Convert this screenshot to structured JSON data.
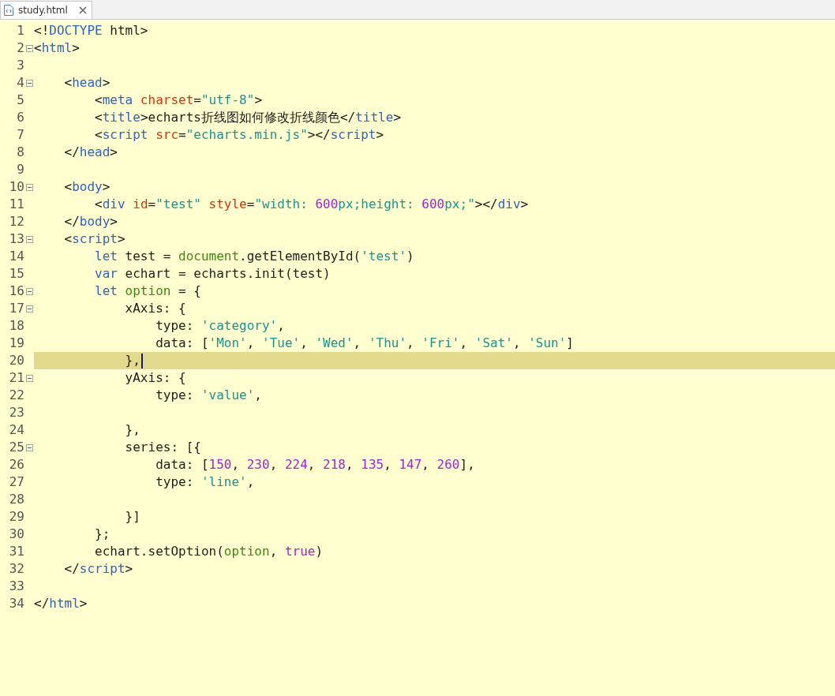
{
  "tab": {
    "label": "study.html",
    "selected": true
  },
  "lines": [
    {
      "number": "1",
      "foldable": false,
      "current": false,
      "tokens": [
        {
          "kind": "plain",
          "text": "<!"
        },
        {
          "kind": "tag",
          "text": "DOCTYPE"
        },
        {
          "kind": "plain",
          "text": " html>"
        }
      ]
    },
    {
      "number": "2",
      "foldable": true,
      "current": false,
      "tokens": [
        {
          "kind": "plain",
          "text": "<"
        },
        {
          "kind": "tag",
          "text": "html"
        },
        {
          "kind": "plain",
          "text": ">"
        }
      ]
    },
    {
      "number": "3",
      "foldable": false,
      "current": false
    },
    {
      "number": "4",
      "foldable": true,
      "current": false,
      "tokens": [
        {
          "kind": "plain",
          "text": "    <"
        },
        {
          "kind": "tag",
          "text": "head"
        },
        {
          "kind": "plain",
          "text": ">"
        }
      ]
    },
    {
      "number": "5",
      "foldable": false,
      "current": false,
      "tokens": [
        {
          "kind": "plain",
          "text": "        <"
        },
        {
          "kind": "tag",
          "text": "meta"
        },
        {
          "kind": "attr",
          "text": " charset"
        },
        {
          "kind": "plain",
          "text": "="
        },
        {
          "kind": "string",
          "text": "\"utf-8\""
        },
        {
          "kind": "plain",
          "text": ">"
        }
      ]
    },
    {
      "number": "6",
      "foldable": false,
      "current": false,
      "tokens": [
        {
          "kind": "plain",
          "text": "        <"
        },
        {
          "kind": "tag",
          "text": "title"
        },
        {
          "kind": "plain",
          "text": ">echarts折线图如何修改折线颜色</"
        },
        {
          "kind": "tag",
          "text": "title"
        },
        {
          "kind": "plain",
          "text": ">"
        }
      ]
    },
    {
      "number": "7",
      "foldable": false,
      "current": false,
      "tokens": [
        {
          "kind": "plain",
          "text": "        <"
        },
        {
          "kind": "tag",
          "text": "script"
        },
        {
          "kind": "attr",
          "text": " src"
        },
        {
          "kind": "plain",
          "text": "="
        },
        {
          "kind": "string",
          "text": "\"echarts.min.js\""
        },
        {
          "kind": "plain",
          "text": "></"
        },
        {
          "kind": "tag",
          "text": "script"
        },
        {
          "kind": "plain",
          "text": ">"
        }
      ]
    },
    {
      "number": "8",
      "foldable": false,
      "current": false,
      "tokens": [
        {
          "kind": "plain",
          "text": "    </"
        },
        {
          "kind": "tag",
          "text": "head"
        },
        {
          "kind": "plain",
          "text": ">"
        }
      ]
    },
    {
      "number": "9",
      "foldable": false,
      "current": false
    },
    {
      "number": "10",
      "foldable": true,
      "current": false,
      "tokens": [
        {
          "kind": "plain",
          "text": "    <"
        },
        {
          "kind": "tag",
          "text": "body"
        },
        {
          "kind": "plain",
          "text": ">"
        }
      ]
    },
    {
      "number": "11",
      "foldable": false,
      "current": false,
      "tokens": [
        {
          "kind": "plain",
          "text": "        <"
        },
        {
          "kind": "tag",
          "text": "div"
        },
        {
          "kind": "attr",
          "text": " id"
        },
        {
          "kind": "plain",
          "text": "="
        },
        {
          "kind": "string",
          "text": "\"test\""
        },
        {
          "kind": "attr",
          "text": " style"
        },
        {
          "kind": "plain",
          "text": "="
        },
        {
          "kind": "string",
          "text": "\"width: "
        },
        {
          "kind": "number",
          "text": "600"
        },
        {
          "kind": "string",
          "text": "px;height: "
        },
        {
          "kind": "number",
          "text": "600"
        },
        {
          "kind": "string",
          "text": "px;\""
        },
        {
          "kind": "plain",
          "text": "></"
        },
        {
          "kind": "tag",
          "text": "div"
        },
        {
          "kind": "plain",
          "text": ">"
        }
      ]
    },
    {
      "number": "12",
      "foldable": false,
      "current": false,
      "tokens": [
        {
          "kind": "plain",
          "text": "    </"
        },
        {
          "kind": "tag",
          "text": "body"
        },
        {
          "kind": "plain",
          "text": ">"
        }
      ]
    },
    {
      "number": "13",
      "foldable": true,
      "current": false,
      "tokens": [
        {
          "kind": "plain",
          "text": "    <"
        },
        {
          "kind": "tag",
          "text": "script"
        },
        {
          "kind": "plain",
          "text": ">"
        }
      ]
    },
    {
      "number": "14",
      "foldable": false,
      "current": false,
      "tokens": [
        {
          "kind": "keyword",
          "text": "        let"
        },
        {
          "kind": "plain",
          "text": " test = "
        },
        {
          "kind": "global",
          "text": "document"
        },
        {
          "kind": "plain",
          "text": ".getElementById("
        },
        {
          "kind": "string",
          "text": "'test'"
        },
        {
          "kind": "plain",
          "text": ")"
        }
      ]
    },
    {
      "number": "15",
      "foldable": false,
      "current": false,
      "tokens": [
        {
          "kind": "keyword",
          "text": "        var"
        },
        {
          "kind": "plain",
          "text": " echart = echarts.init(test)"
        }
      ]
    },
    {
      "number": "16",
      "foldable": true,
      "current": false,
      "tokens": [
        {
          "kind": "keyword",
          "text": "        let"
        },
        {
          "kind": "global",
          "text": " option"
        },
        {
          "kind": "plain",
          "text": " = {"
        }
      ]
    },
    {
      "number": "17",
      "foldable": true,
      "current": false,
      "tokens": [
        {
          "kind": "plain",
          "text": "            xAxis: {"
        }
      ]
    },
    {
      "number": "18",
      "foldable": false,
      "current": false,
      "tokens": [
        {
          "kind": "plain",
          "text": "                type: "
        },
        {
          "kind": "string",
          "text": "'category'"
        },
        {
          "kind": "plain",
          "text": ","
        }
      ]
    },
    {
      "number": "19",
      "foldable": false,
      "current": false,
      "tokens": [
        {
          "kind": "plain",
          "text": "                data: ["
        },
        {
          "kind": "string",
          "text": "'Mon'"
        },
        {
          "kind": "plain",
          "text": ", "
        },
        {
          "kind": "string",
          "text": "'Tue'"
        },
        {
          "kind": "plain",
          "text": ", "
        },
        {
          "kind": "string",
          "text": "'Wed'"
        },
        {
          "kind": "plain",
          "text": ", "
        },
        {
          "kind": "string",
          "text": "'Thu'"
        },
        {
          "kind": "plain",
          "text": ", "
        },
        {
          "kind": "string",
          "text": "'Fri'"
        },
        {
          "kind": "plain",
          "text": ", "
        },
        {
          "kind": "string",
          "text": "'Sat'"
        },
        {
          "kind": "plain",
          "text": ", "
        },
        {
          "kind": "string",
          "text": "'Sun'"
        },
        {
          "kind": "plain",
          "text": "]"
        }
      ]
    },
    {
      "number": "20",
      "foldable": false,
      "current": true,
      "tokens": [
        {
          "kind": "plain",
          "text": "            },"
        }
      ]
    },
    {
      "number": "21",
      "foldable": true,
      "current": false,
      "tokens": [
        {
          "kind": "plain",
          "text": "            yAxis: {"
        }
      ]
    },
    {
      "number": "22",
      "foldable": false,
      "current": false,
      "tokens": [
        {
          "kind": "plain",
          "text": "                type: "
        },
        {
          "kind": "string",
          "text": "'value'"
        },
        {
          "kind": "plain",
          "text": ","
        }
      ]
    },
    {
      "number": "23",
      "foldable": false,
      "current": false
    },
    {
      "number": "24",
      "foldable": false,
      "current": false,
      "tokens": [
        {
          "kind": "plain",
          "text": "            },"
        }
      ]
    },
    {
      "number": "25",
      "foldable": true,
      "current": false,
      "tokens": [
        {
          "kind": "plain",
          "text": "            series: [{"
        }
      ]
    },
    {
      "number": "26",
      "foldable": false,
      "current": false,
      "tokens": [
        {
          "kind": "plain",
          "text": "                data: ["
        },
        {
          "kind": "number",
          "text": "150"
        },
        {
          "kind": "plain",
          "text": ", "
        },
        {
          "kind": "number",
          "text": "230"
        },
        {
          "kind": "plain",
          "text": ", "
        },
        {
          "kind": "number",
          "text": "224"
        },
        {
          "kind": "plain",
          "text": ", "
        },
        {
          "kind": "number",
          "text": "218"
        },
        {
          "kind": "plain",
          "text": ", "
        },
        {
          "kind": "number",
          "text": "135"
        },
        {
          "kind": "plain",
          "text": ", "
        },
        {
          "kind": "number",
          "text": "147"
        },
        {
          "kind": "plain",
          "text": ", "
        },
        {
          "kind": "number",
          "text": "260"
        },
        {
          "kind": "plain",
          "text": "],"
        }
      ]
    },
    {
      "number": "27",
      "foldable": false,
      "current": false,
      "tokens": [
        {
          "kind": "plain",
          "text": "                type: "
        },
        {
          "kind": "string",
          "text": "'line'"
        },
        {
          "kind": "plain",
          "text": ","
        }
      ]
    },
    {
      "number": "28",
      "foldable": false,
      "current": false
    },
    {
      "number": "29",
      "foldable": false,
      "current": false,
      "tokens": [
        {
          "kind": "plain",
          "text": "            }]"
        }
      ]
    },
    {
      "number": "30",
      "foldable": false,
      "current": false,
      "tokens": [
        {
          "kind": "plain",
          "text": "        };"
        }
      ]
    },
    {
      "number": "31",
      "foldable": false,
      "current": false,
      "tokens": [
        {
          "kind": "plain",
          "text": "        echart.setOption("
        },
        {
          "kind": "global",
          "text": "option"
        },
        {
          "kind": "plain",
          "text": ", "
        },
        {
          "kind": "number",
          "text": "true"
        },
        {
          "kind": "plain",
          "text": ")"
        }
      ]
    },
    {
      "number": "32",
      "foldable": false,
      "current": false,
      "tokens": [
        {
          "kind": "plain",
          "text": "    </"
        },
        {
          "kind": "tag",
          "text": "script"
        },
        {
          "kind": "plain",
          "text": ">"
        }
      ]
    },
    {
      "number": "33",
      "foldable": false,
      "current": false
    },
    {
      "number": "34",
      "foldable": false,
      "current": false,
      "tokens": [
        {
          "kind": "plain",
          "text": "</"
        },
        {
          "kind": "tag",
          "text": "html"
        },
        {
          "kind": "plain",
          "text": ">"
        }
      ]
    }
  ]
}
